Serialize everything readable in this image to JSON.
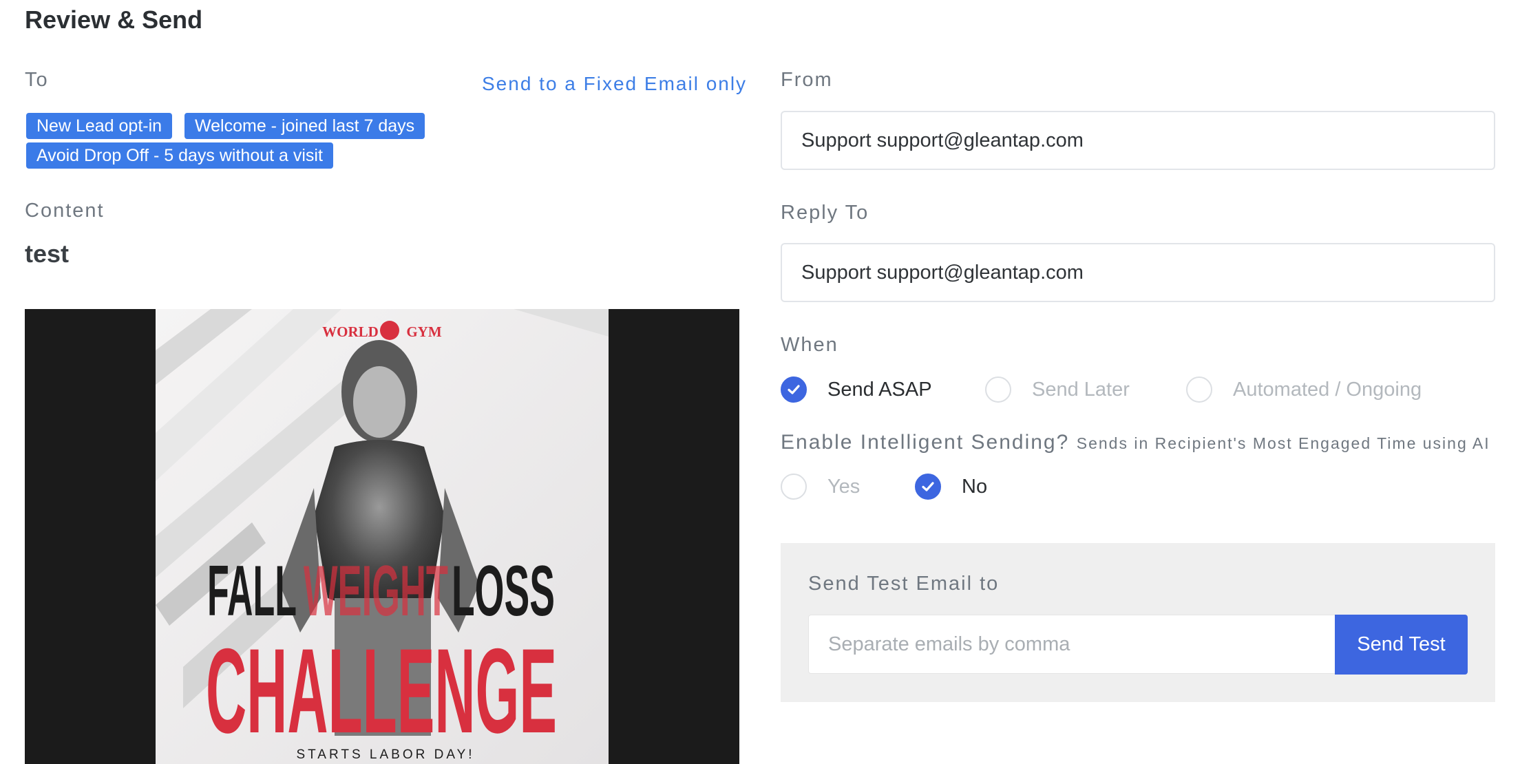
{
  "page_title": "Review & Send",
  "to": {
    "label": "To",
    "fixed_email_link": "Send to a Fixed Email only",
    "tags": [
      "New Lead opt-in",
      "Welcome - joined last 7 days",
      "Avoid Drop Off - 5 days without a visit"
    ]
  },
  "content": {
    "label": "Content",
    "value": "test",
    "preview": {
      "logo_text_left": "WORLD",
      "logo_text_right": "GYM",
      "headline_1": "FALL",
      "headline_2": "WEIGHT",
      "headline_3": "LOSS",
      "headline_4": "CHALLENGE",
      "footer_text": "STARTS LABOR DAY!",
      "accent_color": "#d8303f"
    }
  },
  "from": {
    "label": "From",
    "value": "Support support@gleantap.com"
  },
  "reply_to": {
    "label": "Reply To",
    "value": "Support support@gleantap.com"
  },
  "when": {
    "label": "When",
    "options": [
      {
        "label": "Send ASAP",
        "selected": true
      },
      {
        "label": "Send Later",
        "selected": false
      },
      {
        "label": "Automated / Ongoing",
        "selected": false
      }
    ]
  },
  "intelligent_sending": {
    "label": "Enable Intelligent Sending?",
    "hint": "Sends in Recipient's Most Engaged Time using AI",
    "options": [
      {
        "label": "Yes",
        "selected": false
      },
      {
        "label": "No",
        "selected": true
      }
    ]
  },
  "test_email": {
    "label": "Send Test Email to",
    "placeholder": "Separate emails by comma",
    "button_label": "Send Test"
  },
  "colors": {
    "primary": "#3d66e0",
    "tag_bg": "#3b7be8",
    "link": "#3d7ee6"
  }
}
